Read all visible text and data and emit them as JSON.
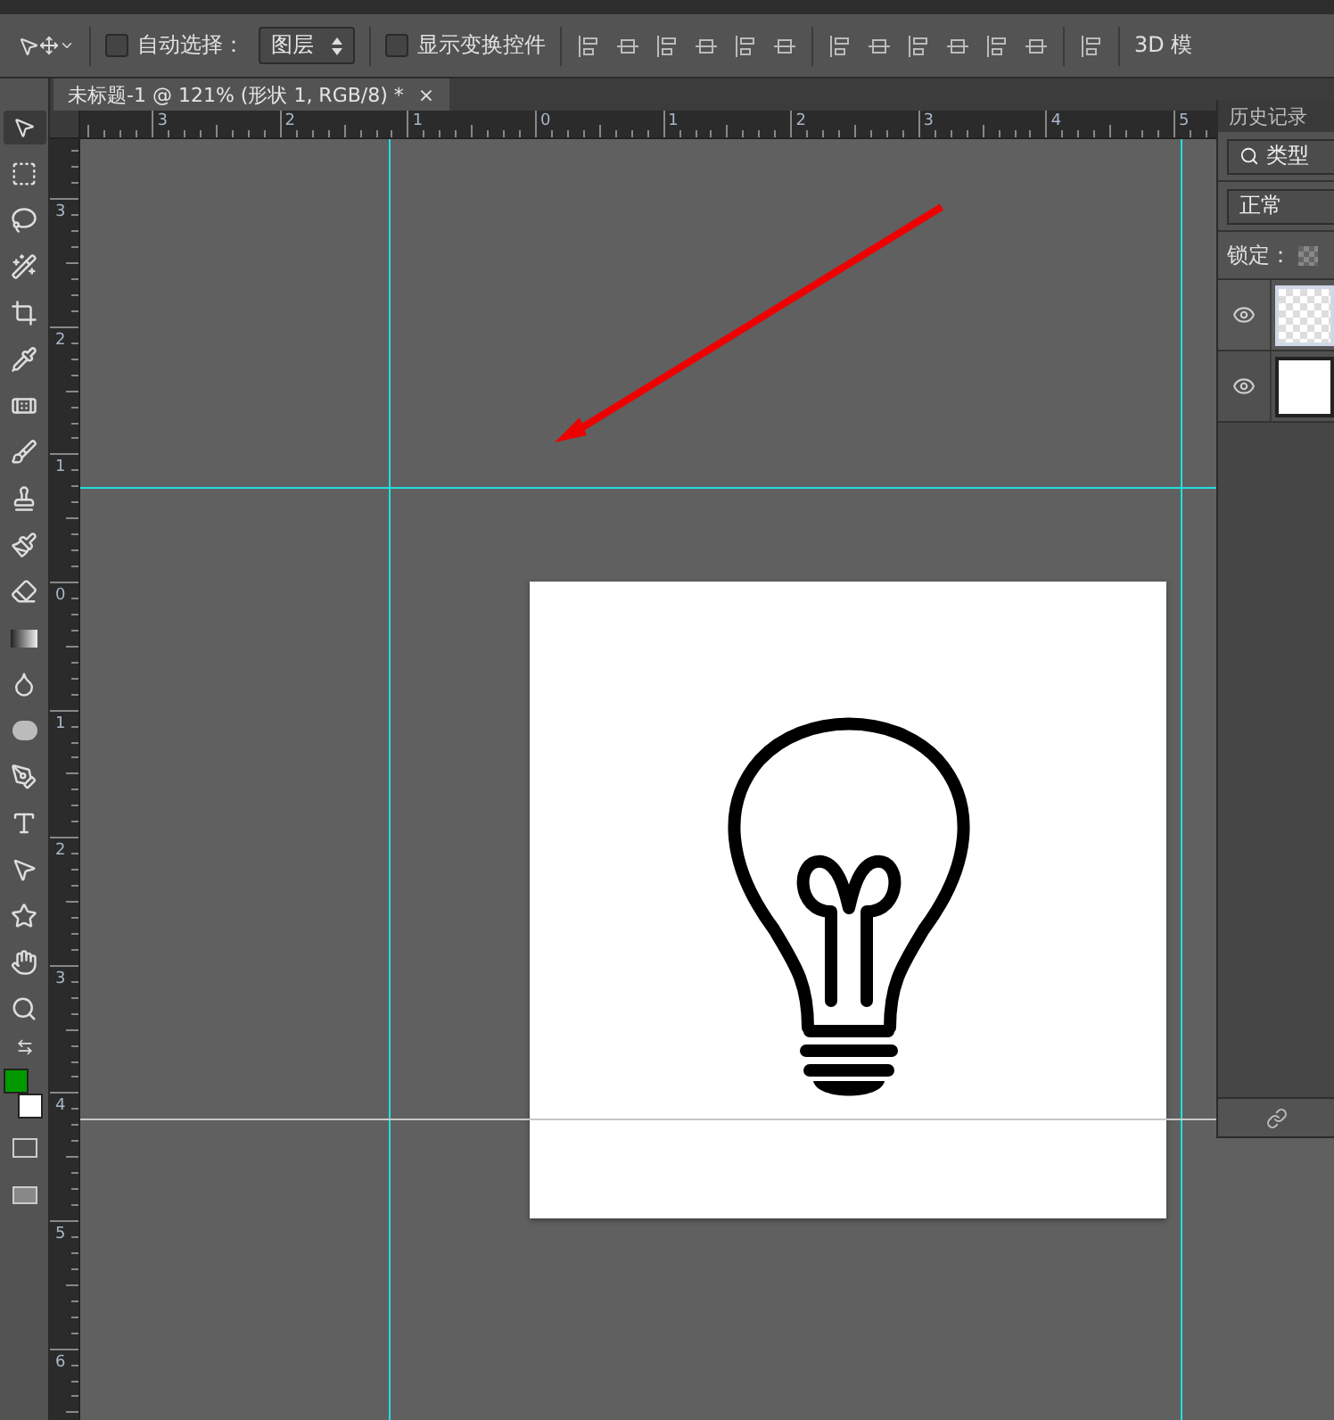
{
  "options_bar": {
    "auto_select": {
      "label": "自动选择：",
      "checked": false
    },
    "target": "图层",
    "show_transform": {
      "label": "显示变换控件",
      "checked": false
    },
    "mode_label": "3D 模"
  },
  "document_tab": {
    "title": "未标题-1 @ 121% (形状 1, RGB/8) *",
    "close": "×"
  },
  "rulers": {
    "horizontal": [
      "3",
      "2",
      "1",
      "0",
      "1",
      "2",
      "3",
      "4",
      "5"
    ],
    "vertical": [
      "3",
      "2",
      "1",
      "0",
      "1",
      "2",
      "3",
      "4",
      "5",
      "6"
    ]
  },
  "swatches": [
    {
      "color": "#009a00"
    },
    {
      "color": "#ffffff"
    }
  ],
  "panel": {
    "tab": "历史记录",
    "filter": "类型",
    "blend_mode": "正常",
    "lock_label": "锁定：",
    "layers": [
      {
        "visible": true,
        "selected": true,
        "kind": "shape"
      },
      {
        "visible": true,
        "selected": false,
        "kind": "fill"
      }
    ]
  }
}
